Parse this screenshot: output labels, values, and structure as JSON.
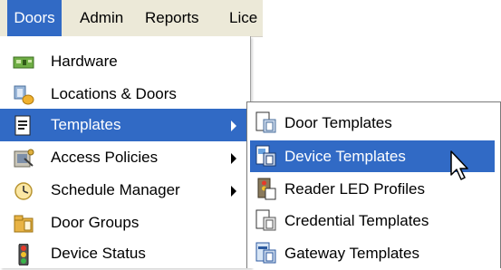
{
  "menubar": {
    "items": [
      {
        "label": "Doors"
      },
      {
        "label": "Admin"
      },
      {
        "label": "Reports"
      },
      {
        "label": "Lice"
      }
    ]
  },
  "doors_menu": {
    "items": [
      {
        "label": "Hardware",
        "icon": "hardware-icon"
      },
      {
        "label": "Locations & Doors",
        "icon": "locations-doors-icon"
      },
      {
        "label": "Templates",
        "icon": "templates-icon",
        "has_submenu": true,
        "highlighted": true
      },
      {
        "label": "Access Policies",
        "icon": "access-policies-icon",
        "has_submenu": true
      },
      {
        "label": "Schedule Manager",
        "icon": "schedule-manager-icon",
        "has_submenu": true
      },
      {
        "label": "Door Groups",
        "icon": "door-groups-icon"
      },
      {
        "label": "Device Status",
        "icon": "device-status-icon"
      }
    ]
  },
  "templates_submenu": {
    "items": [
      {
        "label": "Door Templates",
        "icon": "door-templates-icon"
      },
      {
        "label": "Device Templates",
        "icon": "device-templates-icon",
        "highlighted": true
      },
      {
        "label": "Reader LED Profiles",
        "icon": "reader-led-profiles-icon"
      },
      {
        "label": "Credential Templates",
        "icon": "credential-templates-icon"
      },
      {
        "label": "Gateway Templates",
        "icon": "gateway-templates-icon"
      }
    ]
  },
  "colors": {
    "highlight": "#316ac5",
    "menubar_bg": "#ece9d8",
    "menu_bg": "#ffffff"
  }
}
